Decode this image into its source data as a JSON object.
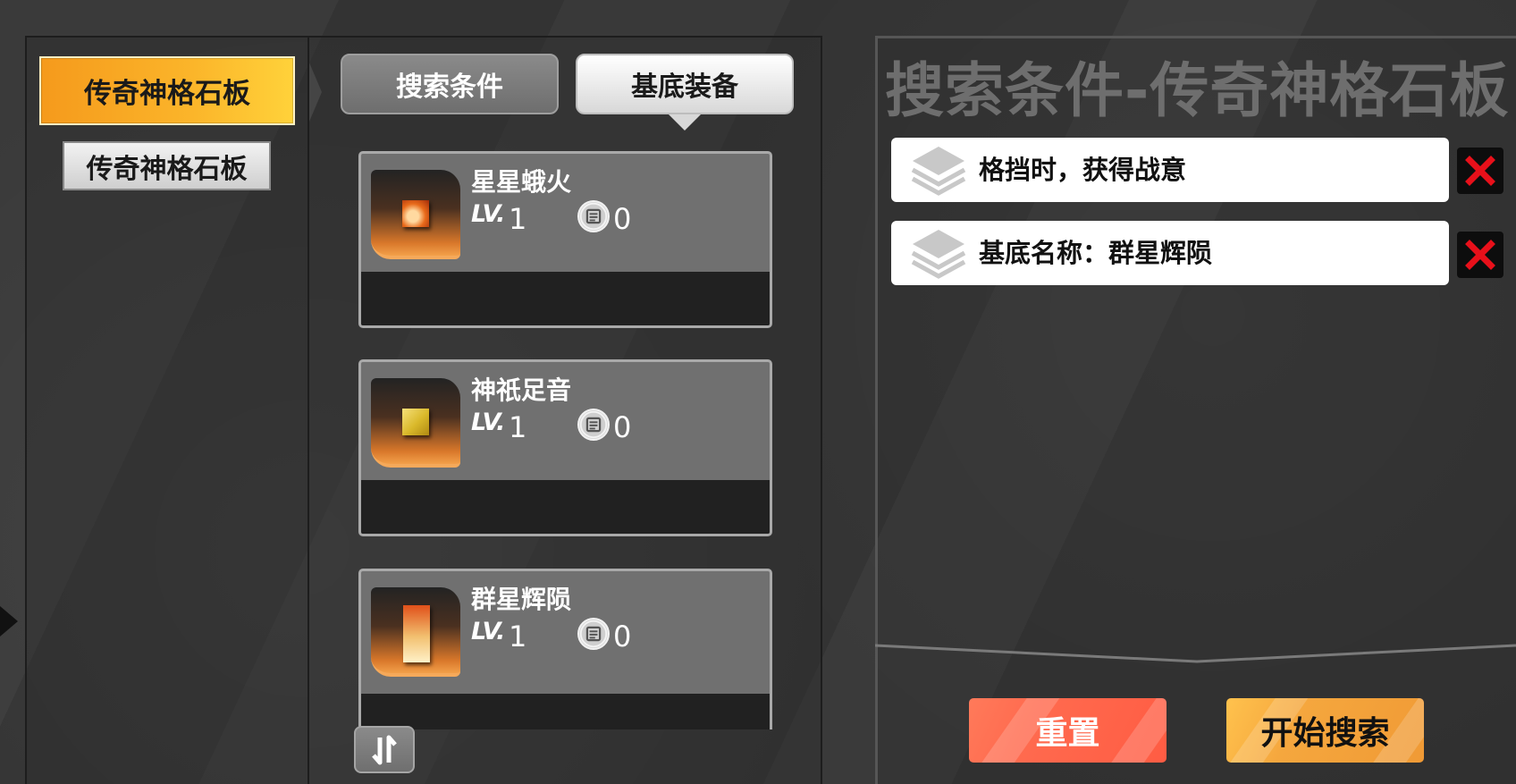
{
  "categories": {
    "active": "传奇神格石板",
    "items": [
      "传奇神格石板"
    ]
  },
  "tabs": {
    "search_conditions": "搜索条件",
    "base_equipment": "基底装备"
  },
  "cards": [
    {
      "name": "星星蛾火",
      "lv_label": "LV.",
      "level": "1",
      "count": "0",
      "gem_color": "#e86a1a"
    },
    {
      "name": "神祇足音",
      "lv_label": "LV.",
      "level": "1",
      "count": "0",
      "gem_color": "#d9b82a"
    },
    {
      "name": "群星辉陨",
      "lv_label": "LV.",
      "level": "1",
      "count": "0",
      "gem_color": "#e0501a"
    }
  ],
  "right": {
    "title": "搜索条件-传奇神格石板",
    "conditions": [
      {
        "label": "格挡时，获得战意"
      },
      {
        "label": "基底名称：群星辉陨"
      }
    ],
    "reset_label": "重置",
    "search_label": "开始搜索"
  },
  "icons": {
    "sort": "sort-icon",
    "layers": "layers-icon",
    "delete": "close-icon",
    "count": "stack-count-icon"
  },
  "colors": {
    "accent_orange": "#f5a73e",
    "reset_red": "#ff6b4f",
    "delete_red": "#e8101a"
  }
}
